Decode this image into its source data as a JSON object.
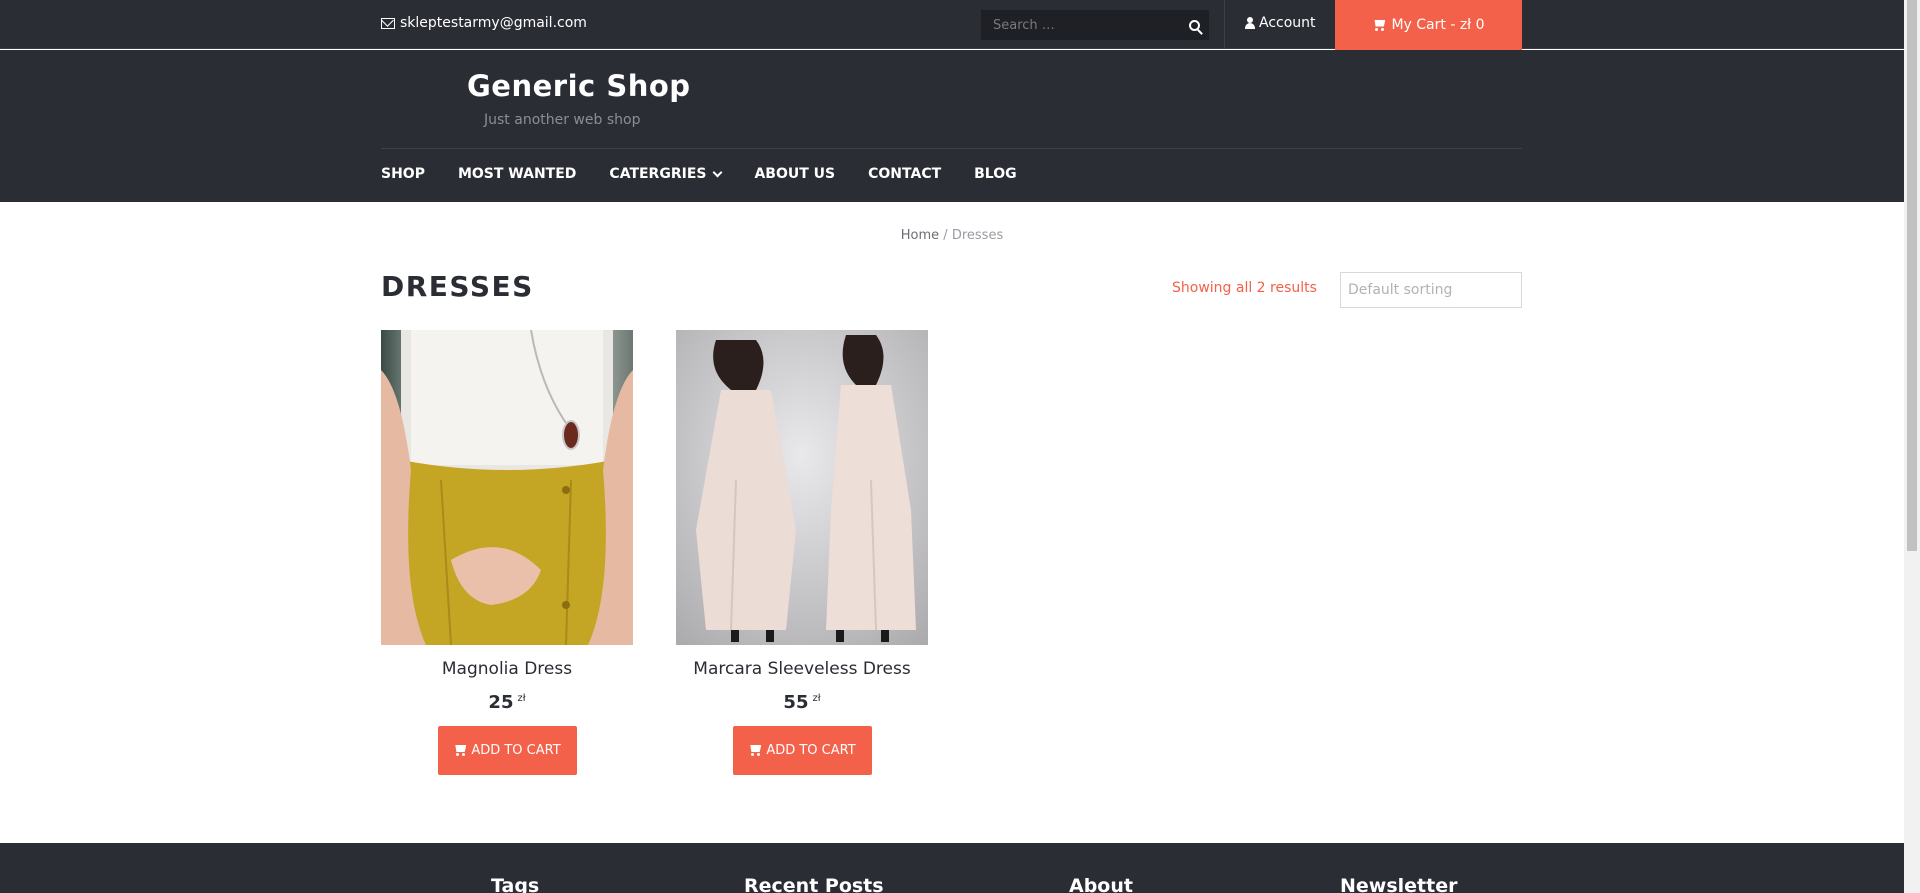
{
  "topbar": {
    "email": "skleptestarmy@gmail.com",
    "search_placeholder": "Search …",
    "account_label": "Account",
    "cart_label": "My Cart - zł 0"
  },
  "header": {
    "brand": "Generic Shop",
    "tagline": "Just another web shop"
  },
  "nav": [
    "SHOP",
    "MOST WANTED",
    "CATERGRIES",
    "ABOUT US",
    "CONTACT",
    "BLOG"
  ],
  "breadcrumb": {
    "home": "Home",
    "separator": " / ",
    "current": "Dresses"
  },
  "page": {
    "title": "DRESSES",
    "result_count": "Showing all 2 results",
    "sort_placeholder": "Default sorting"
  },
  "products": [
    {
      "name": "Magnolia Dress",
      "price": "25",
      "currency": "zł",
      "button": "ADD TO CART"
    },
    {
      "name": "Marcara Sleeveless Dress",
      "price": "55",
      "currency": "zł",
      "button": "ADD TO CART"
    }
  ],
  "footer": {
    "columns": [
      "Tags",
      "Recent Posts",
      "About",
      "Newsletter"
    ]
  },
  "colors": {
    "accent": "#f4614a",
    "dark": "#2b2d35"
  }
}
